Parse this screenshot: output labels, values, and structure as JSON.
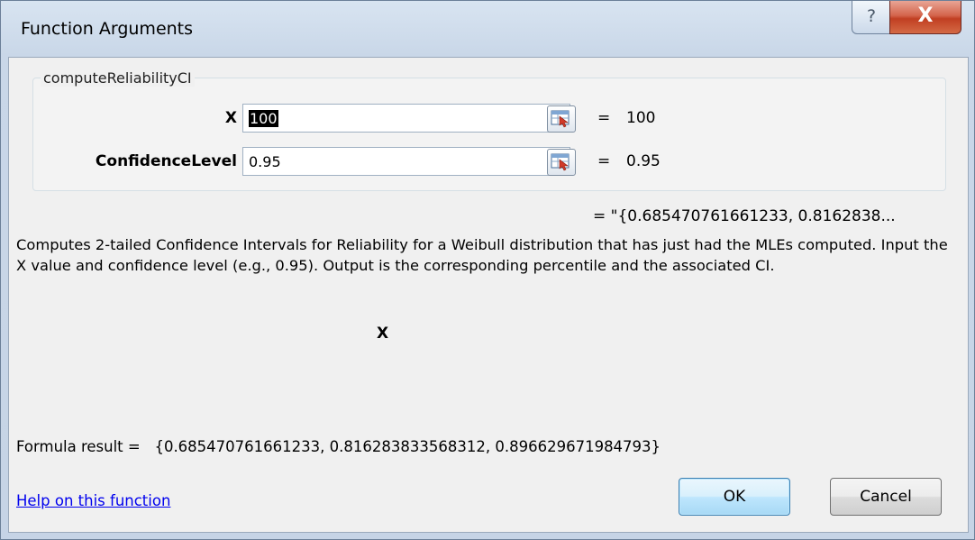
{
  "window": {
    "title": "Function Arguments",
    "help_glyph": "?",
    "close_glyph": "X"
  },
  "function": {
    "name": "computeReliabilityCI",
    "arguments": [
      {
        "label": "X",
        "value": "100",
        "evaluated": "100",
        "equals": "="
      },
      {
        "label": "ConfidenceLevel",
        "value": "0.95",
        "evaluated": "0.95",
        "equals": "="
      }
    ],
    "result_preview": "=   \"{0.685470761661233, 0.8162838...",
    "description": "Computes 2-tailed Confidence Intervals for Reliability for a Weibull distribution that has just had the MLEs computed.  Input the X value and confidence level (e.g., 0.95).  Output is the corresponding percentile and the associated CI.",
    "current_argument": "X"
  },
  "footer": {
    "formula_result": "Formula result =   {0.685470761661233, 0.816283833568312, 0.896629671984793}",
    "help_link": "Help on this function",
    "ok_label": "OK",
    "cancel_label": "Cancel"
  },
  "icons": {
    "help": "help-icon",
    "close": "close-icon",
    "range_selector": "range-selector-icon"
  },
  "colors": {
    "title_bar": "#c9d7e8",
    "close_button": "#c94a2e",
    "link": "#0000ee",
    "ok_border": "#3c7fb1"
  }
}
